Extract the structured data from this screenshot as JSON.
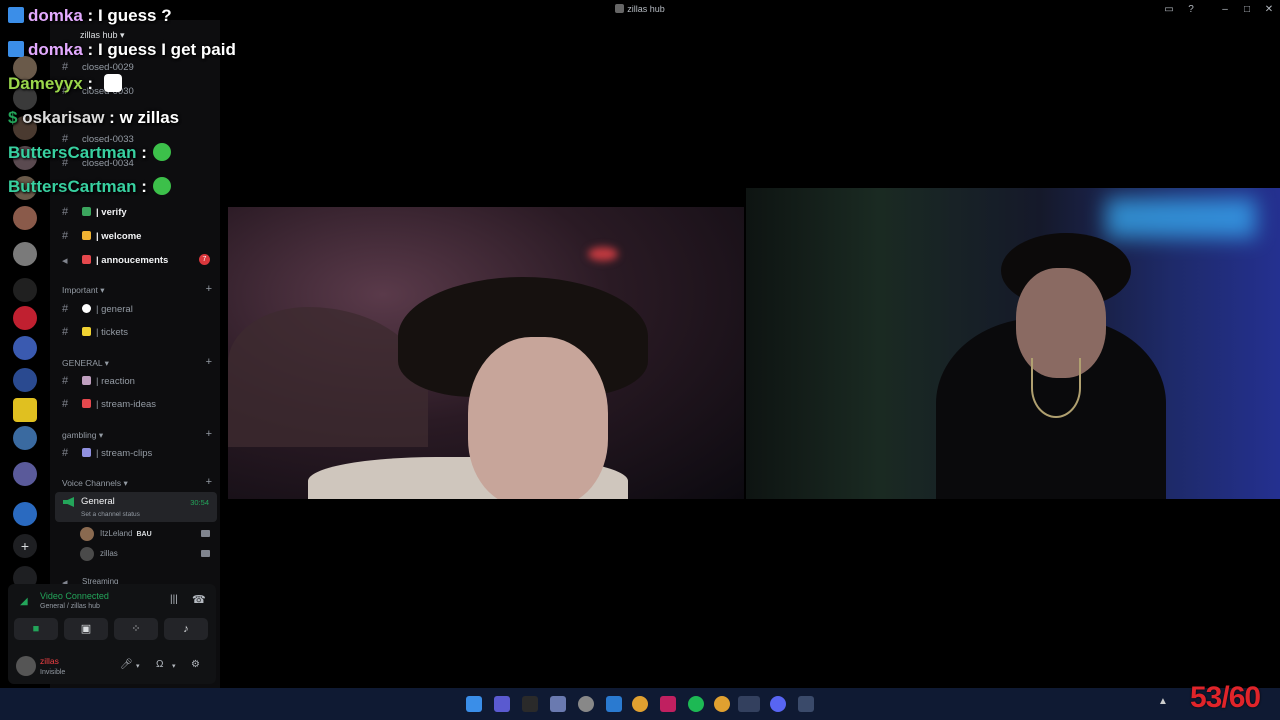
{
  "window": {
    "title": "zillas hub"
  },
  "server": {
    "name": "zillas hub"
  },
  "channels_top": [
    {
      "name": "closed-0029"
    },
    {
      "name": "closed-0030"
    },
    {
      "name": "closed-0033"
    },
    {
      "name": "closed-0034"
    }
  ],
  "channels": [
    {
      "name": "| verify",
      "emoji_color": "#3ba55d"
    },
    {
      "name": "| welcome",
      "emoji_color": "#f0b232"
    },
    {
      "name": "| annoucements",
      "emoji_color": "#e5484d",
      "badge": "7"
    }
  ],
  "categories": {
    "important": {
      "label": "Important",
      "channels": [
        {
          "name": "| general",
          "emoji_color": "#ffffff"
        },
        {
          "name": "| tickets",
          "emoji_color": "#f0d232"
        }
      ]
    },
    "general": {
      "label": "GENERAL",
      "channels": [
        {
          "name": "| reaction",
          "emoji_color": "#c0a0c0"
        },
        {
          "name": "| stream-ideas",
          "emoji_color": "#e5484d"
        }
      ]
    },
    "gambling": {
      "label": "gambling",
      "channels": [
        {
          "name": "| stream-clips",
          "emoji_color": "#9090e0"
        }
      ]
    },
    "voice": {
      "label": "Voice Channels"
    }
  },
  "voice_channel": {
    "name": "General",
    "timer": "30:54",
    "status": "Set a channel status",
    "users": [
      {
        "name": "ItzLeland",
        "tag": "BAU"
      },
      {
        "name": "zillas"
      }
    ],
    "next": "Streaming"
  },
  "voice_panel": {
    "state": "Video Connected",
    "location": "General / zillas hub"
  },
  "user_panel": {
    "name": "zillas",
    "status": "Invisible"
  },
  "chat": [
    {
      "user": "domka",
      "text": "I guess ?",
      "color": "#e3aaff",
      "badge_color": "#3b8ee8"
    },
    {
      "user": "domka",
      "text": "I guess I get paid",
      "color": "#e3aaff",
      "badge_color": "#3b8ee8"
    },
    {
      "user": "Dameyyx",
      "text": "",
      "color": "#9ad64b"
    },
    {
      "user": "oskarisaw",
      "text": "w zillas",
      "color": "#dcdcdc",
      "prefix": "$"
    },
    {
      "user": "ButtersCartman",
      "text": "",
      "color": "#38d0a0",
      "emote": true
    },
    {
      "user": "ButtersCartman",
      "text": "",
      "color": "#38d0a0",
      "emote": true
    }
  ],
  "chat_separator": ":",
  "counter": "53/60",
  "colors": {
    "discord_green": "#23a55a",
    "taskbar": "#0f1a33",
    "counter": "#e0242a"
  }
}
